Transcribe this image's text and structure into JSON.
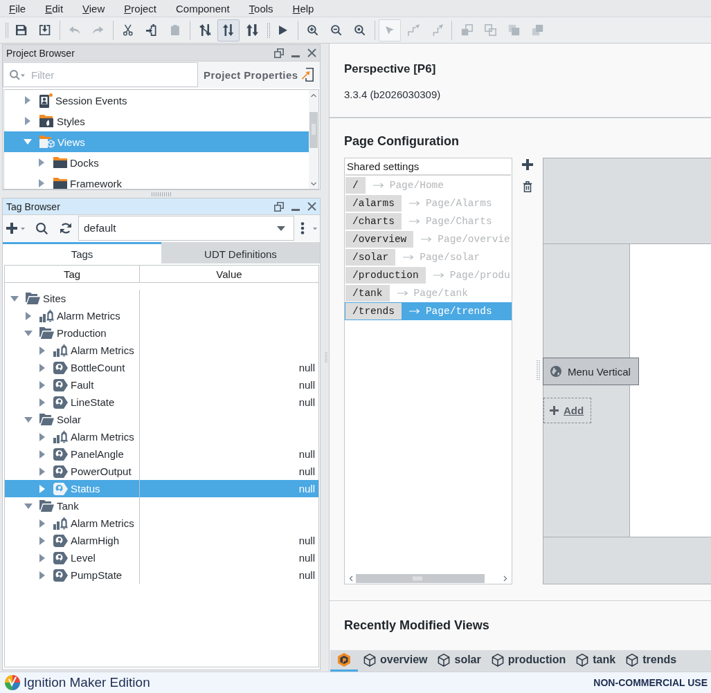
{
  "menu_bar": [
    {
      "label": "File",
      "mnemonic": true
    },
    {
      "label": "Edit",
      "mnemonic": true
    },
    {
      "label": "View",
      "mnemonic": true
    },
    {
      "label": "Project",
      "mnemonic": true
    },
    {
      "label": "Component",
      "mnemonic": false
    },
    {
      "label": "Tools",
      "mnemonic": true
    },
    {
      "label": "Help",
      "mnemonic": true
    }
  ],
  "toolbar": [
    {
      "grip": true,
      "buttons": [
        {
          "kind": "save",
          "disabled": false,
          "selected": false
        },
        {
          "kind": "download",
          "disabled": false,
          "selected": false
        }
      ]
    },
    {
      "grip": false,
      "buttons": [
        {
          "kind": "undo",
          "disabled": true,
          "selected": false
        },
        {
          "kind": "redo",
          "disabled": true,
          "selected": false
        }
      ]
    },
    {
      "grip": false,
      "buttons": [
        {
          "kind": "cut",
          "disabled": false,
          "selected": false
        },
        {
          "kind": "import",
          "disabled": false,
          "selected": false
        },
        {
          "kind": "paste",
          "disabled": true,
          "selected": false
        }
      ]
    },
    {
      "grip": false,
      "buttons": [
        {
          "kind": "unlink",
          "disabled": false,
          "selected": false
        },
        {
          "kind": "swap",
          "disabled": false,
          "selected": true
        },
        {
          "kind": "reorder",
          "disabled": false,
          "selected": false
        }
      ]
    },
    {
      "grip": true,
      "buttons": [
        {
          "kind": "play",
          "disabled": false,
          "selected": false
        }
      ]
    },
    {
      "grip": false,
      "buttons": [
        {
          "kind": "zoomin",
          "disabled": false,
          "selected": false
        },
        {
          "kind": "zoomout",
          "disabled": false,
          "selected": false
        },
        {
          "kind": "zoomfit",
          "disabled": false,
          "selected": false
        }
      ]
    },
    {
      "grip": false,
      "buttons": [
        {
          "kind": "pointer",
          "disabled": true,
          "selected": true
        },
        {
          "kind": "connect",
          "disabled": true,
          "selected": false
        },
        {
          "kind": "route",
          "disabled": true,
          "selected": false
        }
      ]
    },
    {
      "grip": false,
      "buttons": [
        {
          "kind": "front",
          "disabled": true,
          "selected": false
        },
        {
          "kind": "back",
          "disabled": true,
          "selected": false
        },
        {
          "kind": "raise",
          "disabled": true,
          "selected": false
        },
        {
          "kind": "lower",
          "disabled": true,
          "selected": false
        }
      ]
    }
  ],
  "project_browser": {
    "title": "Project Browser",
    "filter_placeholder": "Filter",
    "properties_link": "Project Properties",
    "tree": [
      {
        "label": "Session Events",
        "kind": "session",
        "expanded": false,
        "selected": false
      },
      {
        "label": "Styles",
        "kind": "styles",
        "expanded": false,
        "selected": false
      },
      {
        "label": "Views",
        "kind": "views",
        "expanded": true,
        "selected": true,
        "children": [
          {
            "label": "Docks",
            "kind": "folder",
            "expanded": false,
            "selected": false
          },
          {
            "label": "Framework",
            "kind": "folder",
            "expanded": false,
            "selected": false
          }
        ]
      }
    ]
  },
  "tag_browser": {
    "title": "Tag Browser",
    "provider": "default",
    "tabs": [
      {
        "label": "Tags",
        "selected": true
      },
      {
        "label": "UDT Definitions",
        "selected": false
      }
    ],
    "columns": [
      "Tag",
      "Value"
    ],
    "rows": [
      {
        "label": "Sites",
        "kind": "folder",
        "expanded": true,
        "selected": false,
        "children": [
          {
            "label": "Alarm Metrics",
            "kind": "udt",
            "expanded": false,
            "selected": false
          },
          {
            "label": "Production",
            "kind": "folder",
            "expanded": true,
            "selected": false,
            "children": [
              {
                "label": "Alarm Metrics",
                "kind": "udt",
                "expanded": false,
                "selected": false
              },
              {
                "label": "BottleCount",
                "kind": "tag",
                "expanded": false,
                "selected": false,
                "value": "null"
              },
              {
                "label": "Fault",
                "kind": "tag",
                "expanded": false,
                "selected": false,
                "value": "null"
              },
              {
                "label": "LineState",
                "kind": "tag",
                "expanded": false,
                "selected": false,
                "value": "null"
              }
            ]
          },
          {
            "label": "Solar",
            "kind": "folder",
            "expanded": true,
            "selected": false,
            "children": [
              {
                "label": "Alarm Metrics",
                "kind": "udt",
                "expanded": false,
                "selected": false
              },
              {
                "label": "PanelAngle",
                "kind": "tag",
                "expanded": false,
                "selected": false,
                "value": "null"
              },
              {
                "label": "PowerOutput",
                "kind": "tag",
                "expanded": false,
                "selected": false,
                "value": "null"
              },
              {
                "label": "Status",
                "kind": "tag",
                "expanded": false,
                "selected": true,
                "value": "null"
              }
            ]
          },
          {
            "label": "Tank",
            "kind": "folder",
            "expanded": true,
            "selected": false,
            "children": [
              {
                "label": "Alarm Metrics",
                "kind": "udt",
                "expanded": false,
                "selected": false
              },
              {
                "label": "AlarmHigh",
                "kind": "tag",
                "expanded": false,
                "selected": false,
                "value": "null"
              },
              {
                "label": "Level",
                "kind": "tag",
                "expanded": false,
                "selected": false,
                "value": "null"
              },
              {
                "label": "PumpState",
                "kind": "tag",
                "expanded": false,
                "selected": false,
                "value": "null"
              }
            ]
          }
        ]
      }
    ]
  },
  "module": {
    "title": "Perspective [P6]",
    "version": "3.3.4 (b2026030309)"
  },
  "page_configuration": {
    "title": "Page Configuration",
    "list_header": "Shared settings",
    "pages": [
      {
        "path": "/",
        "target": "Page/Home",
        "selected": false
      },
      {
        "path": "/alarms",
        "target": "Page/Alarms",
        "selected": false
      },
      {
        "path": "/charts",
        "target": "Page/Charts",
        "selected": false
      },
      {
        "path": "/overview",
        "target": "Page/overvie",
        "selected": false
      },
      {
        "path": "/solar",
        "target": "Page/solar",
        "selected": false
      },
      {
        "path": "/production",
        "target": "Page/produ",
        "selected": false
      },
      {
        "path": "/tank",
        "target": "Page/tank",
        "selected": false
      },
      {
        "path": "/trends",
        "target": "Page/trends",
        "selected": true
      }
    ],
    "preview": {
      "component": "Menu Vertical",
      "add_button": "Add"
    }
  },
  "recently_modified_views": {
    "title": "Recently Modified Views",
    "tabs": [
      {
        "kind": "project",
        "selected": true
      },
      {
        "kind": "view",
        "label": "overview",
        "selected": false
      },
      {
        "kind": "view",
        "label": "solar",
        "selected": false
      },
      {
        "kind": "view",
        "label": "production",
        "selected": false
      },
      {
        "kind": "view",
        "label": "tank",
        "selected": false
      },
      {
        "kind": "view",
        "label": "trends",
        "selected": false
      }
    ]
  },
  "status_bar": {
    "edition": "Ignition Maker Edition",
    "license": "NON-COMMERCIAL USE"
  }
}
